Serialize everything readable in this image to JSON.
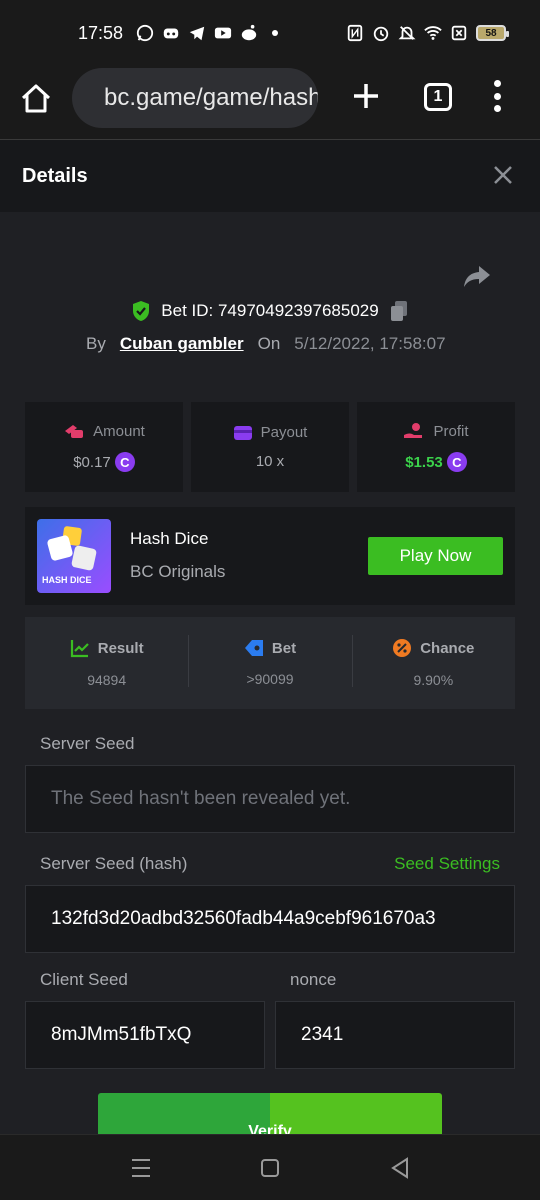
{
  "status": {
    "time": "17:58",
    "battery": "58",
    "left_icons": [
      "whatsapp-icon",
      "discord-icon",
      "telegram-icon",
      "youtube-icon",
      "reddit-icon"
    ],
    "right_icons": [
      "nfc-icon",
      "alarm-icon",
      "mute-icon",
      "wifi-icon",
      "no-sim-icon"
    ]
  },
  "browser": {
    "url": "bc.game/game/hash-dice",
    "tab_count": "1"
  },
  "details": {
    "title": "Details"
  },
  "bet": {
    "id_label": "Bet ID: 74970492397685029",
    "by_label": "By",
    "user": "Cuban gambler",
    "on_label": "On",
    "date": "5/12/2022, 17:58:07"
  },
  "stats": {
    "amount_label": "Amount",
    "amount_value": "$0.17",
    "payout_label": "Payout",
    "payout_value": "10 x",
    "profit_label": "Profit",
    "profit_value": "$1.53",
    "coin_symbol": "C"
  },
  "game": {
    "thumb_label": "HASH DICE",
    "name": "Hash Dice",
    "provider": "BC Originals",
    "play_label": "Play Now"
  },
  "result": {
    "result_label": "Result",
    "result_value": "94894",
    "bet_label": "Bet",
    "bet_value": ">90099",
    "chance_label": "Chance",
    "chance_value": "9.90%"
  },
  "seeds": {
    "server_seed_label": "Server Seed",
    "server_seed_placeholder": "The Seed hasn't been revealed yet.",
    "server_hash_label": "Server Seed (hash)",
    "seed_settings_label": "Seed Settings",
    "server_hash_value": "132fd3d20adbd32560fadb44a9cebf961670a3",
    "client_seed_label": "Client Seed",
    "client_seed_value": "8mJMm51fbTxQ",
    "nonce_label": "nonce",
    "nonce_value": "2341"
  },
  "verify_label": "Verify",
  "colors": {
    "accent_green": "#3bbd22",
    "profit_green": "#3bd14b",
    "coin_purple": "#8a3cf0",
    "panel": "#17181b",
    "background": "#1f2024"
  }
}
